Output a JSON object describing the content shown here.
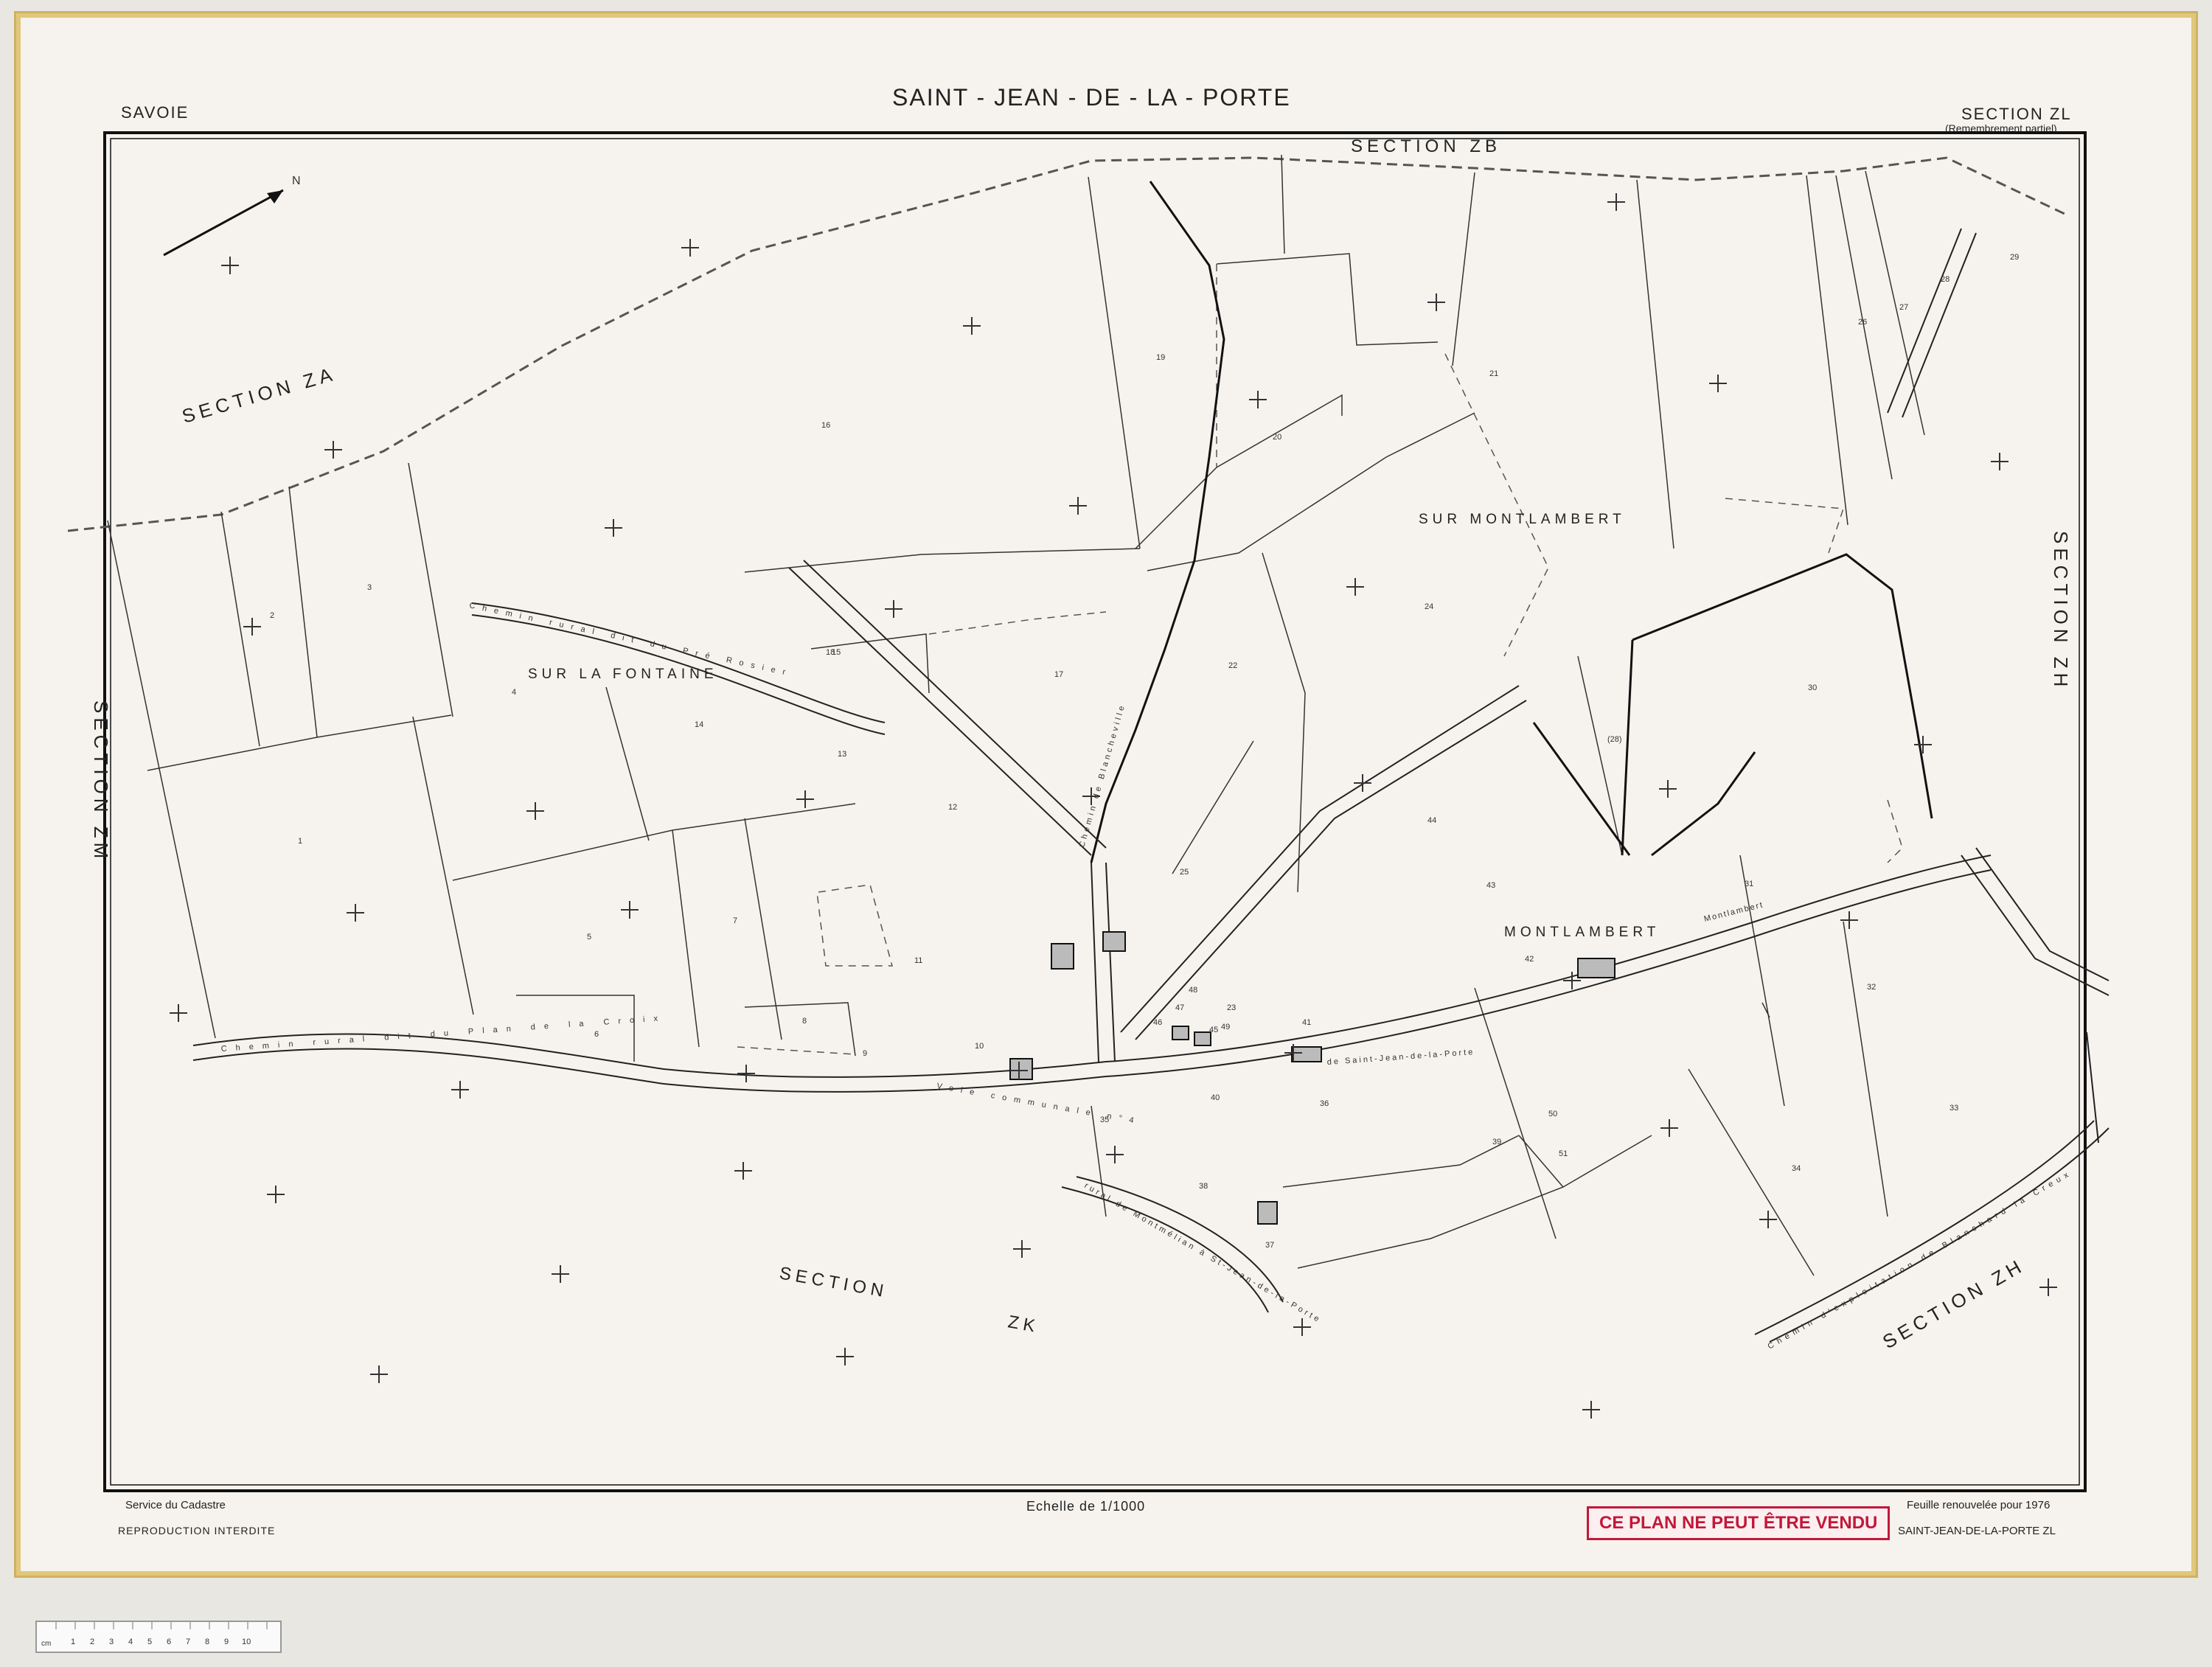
{
  "header": {
    "region": "SAVOIE",
    "commune": "SAINT - JEAN - DE - LA - PORTE",
    "section": "SECTION ZL",
    "section_note": "(Remembrement partiel)"
  },
  "footer": {
    "service": "Service du Cadastre",
    "reproduction": "REPRODUCTION INTERDITE",
    "scale": "Echelle de 1/1000",
    "renewed": "Feuille renouvelée pour 1976",
    "sheet_ref": "SAINT-JEAN-DE-LA-PORTE  ZL",
    "stamp": "CE PLAN NE PEUT ÊTRE VENDU"
  },
  "map": {
    "north": "N",
    "sections": {
      "zb": "SECTION ZB",
      "za": "SECTION ZA",
      "zm": "SECTION ZM",
      "zk_1": "SECTION",
      "zk_2": "ZK",
      "zh_right": "SECTION ZH",
      "zh_bottom": "SECTION ZH"
    },
    "lieux_dits": {
      "sur_montlambert": "SUR MONTLAMBERT",
      "sur_la_fontaine": "SUR LA FONTAINE",
      "montlambert": "MONTLAMBERT"
    },
    "roads": {
      "plan_de_la_croix": "Chemin rural dit du Plan de la Croix",
      "voie_communale": "Voie communale n°4",
      "saint_jean": "de Saint-Jean-de-la-Porte",
      "montlambert_road": "Montlambert",
      "pre_rosier": "Chemin rural dit du Pré Rosier",
      "blancheville": "Chemin de Blancheville",
      "exploitation": "Chemin d'exploitation de Blanchard la Creux",
      "montmelian": "rural de Montmélian à St-Jean-de-la-Porte"
    },
    "parcels": [
      "1",
      "2",
      "3",
      "4",
      "5",
      "6",
      "7",
      "8",
      "9",
      "10",
      "11",
      "12",
      "13",
      "14",
      "15",
      "16",
      "17",
      "18",
      "19",
      "20",
      "21",
      "22",
      "23",
      "24",
      "25",
      "26",
      "27",
      "28",
      "29",
      "30",
      "31",
      "32",
      "33",
      "34",
      "35",
      "36",
      "37",
      "38",
      "39",
      "40",
      "41",
      "42",
      "43",
      "44",
      "45",
      "46",
      "47",
      "48",
      "49",
      "50",
      "51",
      "(28)"
    ]
  },
  "ruler": {
    "digits": [
      "1",
      "2",
      "3",
      "4",
      "5",
      "6",
      "7",
      "8",
      "9",
      "10"
    ],
    "unit": "cm"
  }
}
